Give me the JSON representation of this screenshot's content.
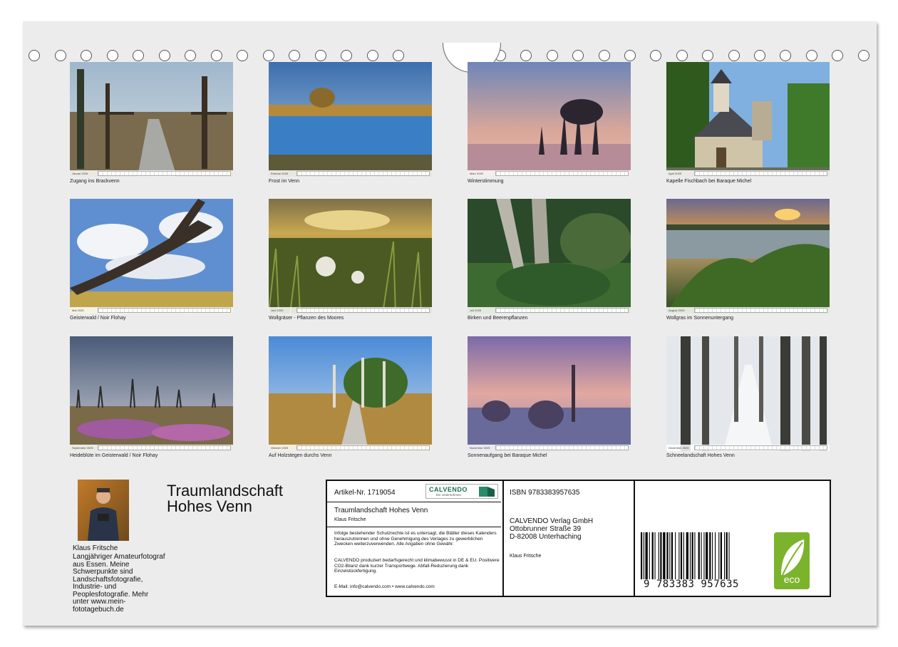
{
  "months": [
    {
      "caption": "Zugang ins Brackvenn",
      "month": "Januar 2025"
    },
    {
      "caption": "Frost im Venn",
      "month": "Februar 2025"
    },
    {
      "caption": "Winterstimmung",
      "month": "März 2025"
    },
    {
      "caption": "Kapelle Fischbach bei Baraque Michel",
      "month": "April 2025"
    },
    {
      "caption": "Geisterwald / Noir Flohay",
      "month": "Mai 2025"
    },
    {
      "caption": "Wollgräser - Pflanzen des Moores",
      "month": "Juni 2025"
    },
    {
      "caption": "Birken und Beerenpflanzen",
      "month": "Juli 2025"
    },
    {
      "caption": "Wollgras im Sonnenuntergang",
      "month": "August 2025"
    },
    {
      "caption": "Heideblüte im Geisterwald / Noir Flohay",
      "month": "September 2025"
    },
    {
      "caption": "Auf Holzstegen durchs Venn",
      "month": "Oktober 2025"
    },
    {
      "caption": "Sonnenaufgang bei Baraque Michel",
      "month": "November 2025"
    },
    {
      "caption": "Schneelandschaft Hohes Venn",
      "month": "Dezember 2025"
    }
  ],
  "title_line1": "Traumlandschaft",
  "title_line2": "Hohes Venn",
  "author": {
    "name": "Klaus Fritsche",
    "bio": "Langjähriger Amateurfotograf aus Essen. Meine Schwerpunkte sind Landschaftsfotografie, Industrie- und Peoplesfotografie. Mehr unter www.mein-fototagebuch.de"
  },
  "info": {
    "article": "Artikel-Nr. 1719054",
    "logo_text": "CALVENDO",
    "logo_sub": "Ein Unternehmen",
    "book_title": "Traumlandschaft Hohes Venn",
    "book_author": "Klaus Fritsche",
    "legal": "Infolge bestehender Schutzrechte ist es untersagt, die Blätter dieses Kalenders herauszutrennen und ohne Genehmigung des Verlages zu gewerblichen Zwecken weiterzuverwenden. Alle Angaben ohne Gewähr.",
    "eco_note": "CALVENDO produziert bedarfsgerecht und klimabewusst in DE & EU. Positivere CO2-Bilanz dank kurzer Transportwege. Abfall-Reduzierung dank Einzelstückfertigung.",
    "contact": "E-Mail: info@calvendo.com • www.calvendo.com",
    "isbn": "ISBN 9783383957635",
    "publisher_name": "CALVENDO Verlag GmbH",
    "publisher_street": "Ottobrunner Straße 39",
    "publisher_city": "D-82008 Unterhaching",
    "publisher_author": "Klaus Fritsche",
    "barcode_digits": "9 783383 957635",
    "eco_label": "eco"
  },
  "colors": {
    "accent_green": "#7bb42c",
    "sheet": "#ececec"
  }
}
